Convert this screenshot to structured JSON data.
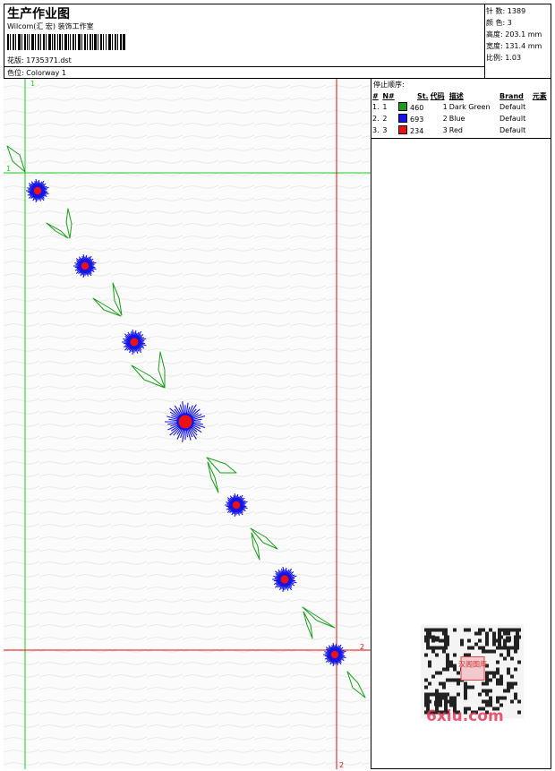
{
  "header": {
    "title": "生产作业图",
    "company": "Wilcom(汇 宏) 装饰工作室",
    "design_label": "花版:",
    "design_value": "1735371.dst",
    "colorway_label": "色位:",
    "colorway_value": "Colorway 1"
  },
  "stats": [
    {
      "label": "针 数:",
      "value": "1389"
    },
    {
      "label": "颜 色:",
      "value": "3"
    },
    {
      "label": "高度:",
      "value": "203.1 mm"
    },
    {
      "label": "宽度:",
      "value": "131.4 mm"
    },
    {
      "label": "比例:",
      "value": "1.03"
    }
  ],
  "stop_sequence": {
    "title": "停止顺序:",
    "columns": [
      "#",
      "N#",
      "St.",
      "代码",
      "描述",
      "Brand",
      "元素"
    ],
    "rows": [
      {
        "num": "1.",
        "n": "1",
        "st": "460",
        "code": "1",
        "desc": "Dark Green",
        "brand": "Default",
        "color": "#1a9c1a"
      },
      {
        "num": "2.",
        "n": "2",
        "st": "693",
        "code": "2",
        "desc": "Blue",
        "brand": "Default",
        "color": "#1414e6"
      },
      {
        "num": "3.",
        "n": "3",
        "st": "234",
        "code": "3",
        "desc": "Red",
        "brand": "Default",
        "color": "#ee1111"
      }
    ]
  },
  "guides": {
    "green_v": "1",
    "green_h": "1",
    "red_v": "2",
    "red_h": "2"
  },
  "colors": {
    "guide_green": "#22cc22",
    "guide_red": "#dd1111",
    "thread_green": "#1a9c1a",
    "thread_blue": "#1414e6",
    "thread_red": "#ee1111"
  },
  "watermark": {
    "stamp": "汉阁图库",
    "site": "6xiu.com"
  }
}
